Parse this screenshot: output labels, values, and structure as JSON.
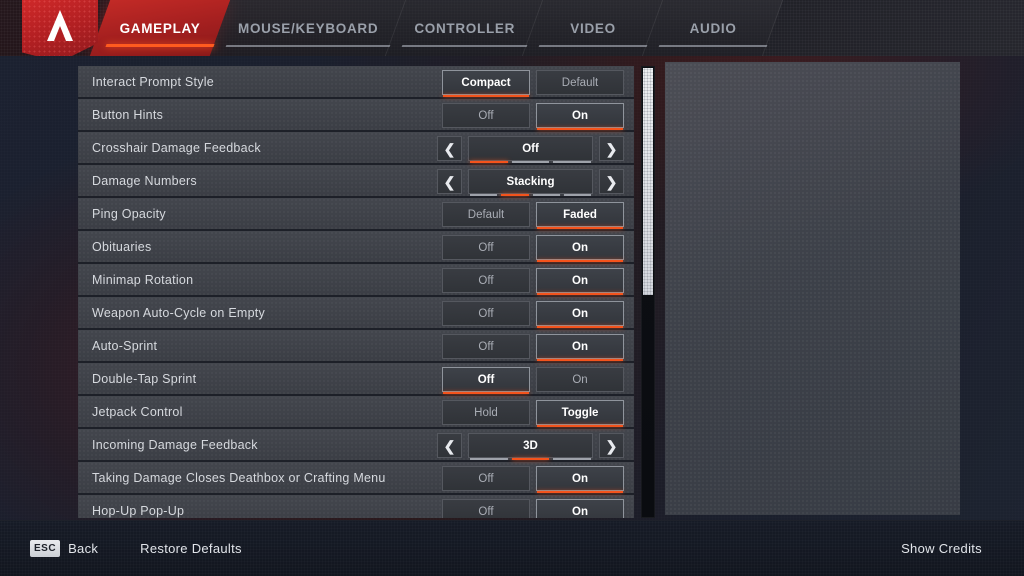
{
  "header": {
    "logo_icon": "apex-legends-logo-icon",
    "tabs": [
      {
        "label": "GAMEPLAY",
        "active": true
      },
      {
        "label": "MOUSE/KEYBOARD",
        "active": false
      },
      {
        "label": "CONTROLLER",
        "active": false
      },
      {
        "label": "VIDEO",
        "active": false
      },
      {
        "label": "AUDIO",
        "active": false
      }
    ]
  },
  "settings": {
    "rows": [
      {
        "label": "Interact Prompt Style",
        "type": "toggle",
        "options": [
          "Compact",
          "Default"
        ],
        "selected": 0
      },
      {
        "label": "Button Hints",
        "type": "toggle",
        "options": [
          "Off",
          "On"
        ],
        "selected": 1
      },
      {
        "label": "Crosshair Damage Feedback",
        "type": "stepper",
        "value": "Off",
        "segments": 3,
        "segment_index": 0
      },
      {
        "label": "Damage Numbers",
        "type": "stepper",
        "value": "Stacking",
        "segments": 4,
        "segment_index": 1
      },
      {
        "label": "Ping Opacity",
        "type": "toggle",
        "options": [
          "Default",
          "Faded"
        ],
        "selected": 1
      },
      {
        "label": "Obituaries",
        "type": "toggle",
        "options": [
          "Off",
          "On"
        ],
        "selected": 1
      },
      {
        "label": "Minimap Rotation",
        "type": "toggle",
        "options": [
          "Off",
          "On"
        ],
        "selected": 1
      },
      {
        "label": "Weapon Auto-Cycle on Empty",
        "type": "toggle",
        "options": [
          "Off",
          "On"
        ],
        "selected": 1
      },
      {
        "label": "Auto-Sprint",
        "type": "toggle",
        "options": [
          "Off",
          "On"
        ],
        "selected": 1
      },
      {
        "label": "Double-Tap Sprint",
        "type": "toggle",
        "options": [
          "Off",
          "On"
        ],
        "selected": 0
      },
      {
        "label": "Jetpack Control",
        "type": "toggle",
        "options": [
          "Hold",
          "Toggle"
        ],
        "selected": 1
      },
      {
        "label": "Incoming Damage Feedback",
        "type": "stepper",
        "value": "3D",
        "segments": 3,
        "segment_index": 1
      },
      {
        "label": "Taking Damage Closes Deathbox or Crafting Menu",
        "type": "toggle",
        "options": [
          "Off",
          "On"
        ],
        "selected": 1
      },
      {
        "label": "Hop-Up Pop-Up",
        "type": "toggle",
        "options": [
          "Off",
          "On"
        ],
        "selected": 1
      }
    ],
    "arrow_left_icon": "chevron-left-icon",
    "arrow_right_icon": "chevron-right-icon",
    "arrow_left_glyph": "❮",
    "arrow_right_glyph": "❯"
  },
  "footer": {
    "back_key": "ESC",
    "back_label": "Back",
    "restore_defaults_label": "Restore Defaults",
    "show_credits_label": "Show Credits"
  },
  "colors": {
    "accent_orange": "#f4531c",
    "brand_red": "#c22a26",
    "row_bg": "#3f424a",
    "panel_bg": "#4a4e56"
  }
}
